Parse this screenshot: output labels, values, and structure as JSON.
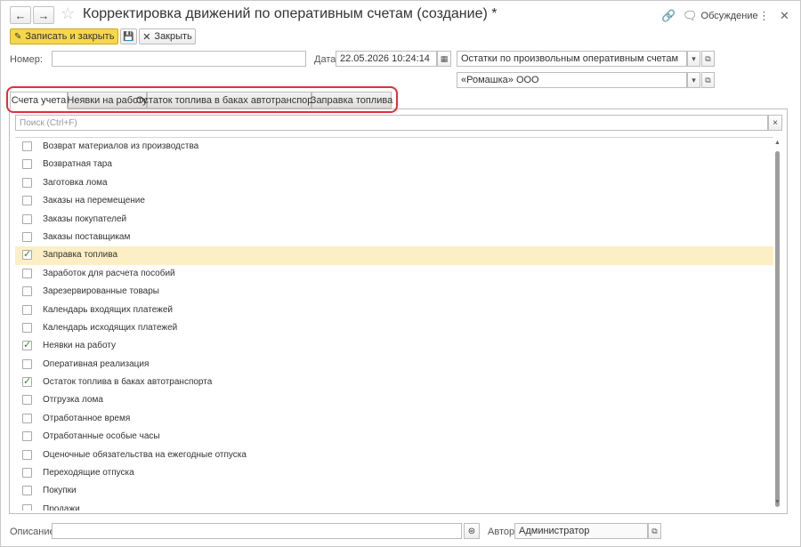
{
  "window": {
    "title": "Корректировка движений по оперативным счетам (создание) *",
    "discussion_label": "Обсуждение"
  },
  "toolbar": {
    "save_close_label": "Записать и закрыть",
    "close_label": "Закрыть"
  },
  "form": {
    "number_label": "Номер:",
    "number_value": "",
    "date_label": "Дата:",
    "date_value": "22.05.2026 10:24:14",
    "register_value": "Остатки по произвольным оперативным счетам",
    "organization_value": "«Ромашка» ООО"
  },
  "tabs": [
    {
      "label": "Счета учета",
      "active": true
    },
    {
      "label": "Неявки на работу",
      "active": false
    },
    {
      "label": "Остаток топлива в баках автотранспорта",
      "active": false
    },
    {
      "label": "Заправка топлива",
      "active": false
    }
  ],
  "search": {
    "placeholder": "Поиск (Ctrl+F)",
    "clear_label": "×"
  },
  "accounts": [
    {
      "label": "Возврат материалов из производства",
      "checked": false,
      "selected": false
    },
    {
      "label": "Возвратная тара",
      "checked": false,
      "selected": false
    },
    {
      "label": "Заготовка лома",
      "checked": false,
      "selected": false
    },
    {
      "label": "Заказы на перемещение",
      "checked": false,
      "selected": false
    },
    {
      "label": "Заказы покупателей",
      "checked": false,
      "selected": false
    },
    {
      "label": "Заказы поставщикам",
      "checked": false,
      "selected": false
    },
    {
      "label": "Заправка топлива",
      "checked": true,
      "selected": true
    },
    {
      "label": "Заработок для расчета пособий",
      "checked": false,
      "selected": false
    },
    {
      "label": "Зарезервированные товары",
      "checked": false,
      "selected": false
    },
    {
      "label": "Календарь входящих платежей",
      "checked": false,
      "selected": false
    },
    {
      "label": "Календарь исходящих платежей",
      "checked": false,
      "selected": false
    },
    {
      "label": "Неявки на работу",
      "checked": true,
      "selected": false
    },
    {
      "label": "Оперативная реализация",
      "checked": false,
      "selected": false
    },
    {
      "label": "Остаток топлива в баках автотранспорта",
      "checked": true,
      "selected": false
    },
    {
      "label": "Отгрузка лома",
      "checked": false,
      "selected": false
    },
    {
      "label": "Отработанное время",
      "checked": false,
      "selected": false
    },
    {
      "label": "Отработанные особые часы",
      "checked": false,
      "selected": false
    },
    {
      "label": "Оценочные обязательства на ежегодные отпуска",
      "checked": false,
      "selected": false
    },
    {
      "label": "Переходящие отпуска",
      "checked": false,
      "selected": false
    },
    {
      "label": "Покупки",
      "checked": false,
      "selected": false
    },
    {
      "label": "Продажи",
      "checked": false,
      "selected": false
    }
  ],
  "footer": {
    "description_label": "Описание:",
    "description_value": "",
    "author_label": "Автор:",
    "author_value": "Администратор"
  },
  "colors": {
    "primary_button": "#f5d74a",
    "selected_row": "#fcefc6",
    "highlight_outline": "#e0303a",
    "checkmark": "#2e8b2e"
  }
}
